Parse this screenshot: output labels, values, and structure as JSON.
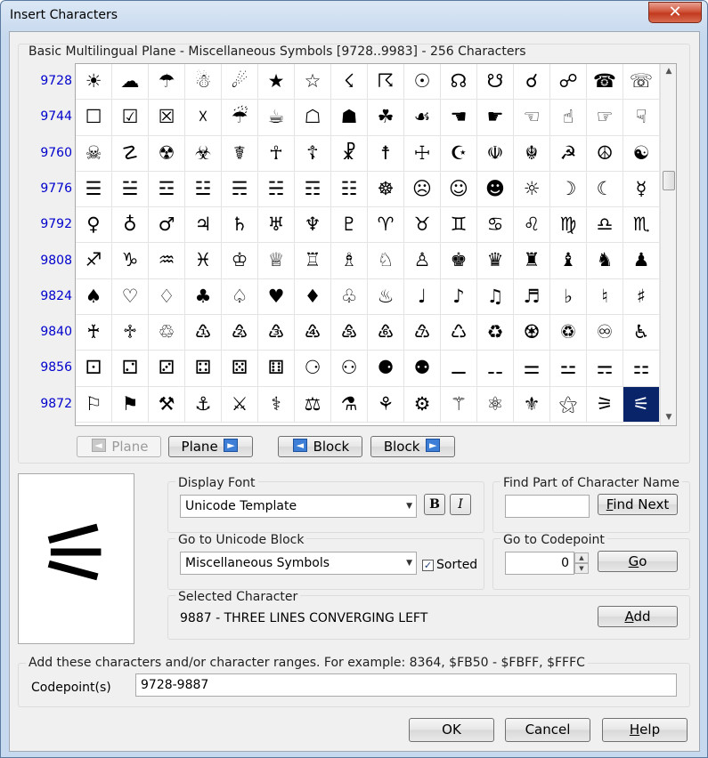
{
  "window": {
    "title": "Insert Characters",
    "close_glyph": "✕"
  },
  "char_panel": {
    "group_label": "Basic Multilingual Plane - Miscellaneous Symbols [9728..9983] - 256 Characters",
    "row_labels": [
      "9728",
      "9744",
      "9760",
      "9776",
      "9792",
      "9808",
      "9824",
      "9840",
      "9856",
      "9872"
    ],
    "glyph_rows": [
      [
        "☀",
        "☁",
        "☂",
        "☃",
        "☄",
        "★",
        "☆",
        "☇",
        "☈",
        "☉",
        "☊",
        "☋",
        "☌",
        "☍",
        "☎",
        "☏"
      ],
      [
        "☐",
        "☑",
        "☒",
        "☓",
        "☔",
        "☕",
        "☖",
        "☗",
        "☘",
        "☙",
        "☚",
        "☛",
        "☜",
        "☝",
        "☞",
        "☟"
      ],
      [
        "☠",
        "☡",
        "☢",
        "☣",
        "☤",
        "☥",
        "☦",
        "☧",
        "☨",
        "☩",
        "☪",
        "☫",
        "☬",
        "☭",
        "☮",
        "☯"
      ],
      [
        "☰",
        "☱",
        "☲",
        "☳",
        "☴",
        "☵",
        "☶",
        "☷",
        "☸",
        "☹",
        "☺",
        "☻",
        "☼",
        "☽",
        "☾",
        "☿"
      ],
      [
        "♀",
        "♁",
        "♂",
        "♃",
        "♄",
        "♅",
        "♆",
        "♇",
        "♈",
        "♉",
        "♊",
        "♋",
        "♌",
        "♍",
        "♎",
        "♏"
      ],
      [
        "♐",
        "♑",
        "♒",
        "♓",
        "♔",
        "♕",
        "♖",
        "♗",
        "♘",
        "♙",
        "♚",
        "♛",
        "♜",
        "♝",
        "♞",
        "♟"
      ],
      [
        "♠",
        "♡",
        "♢",
        "♣",
        "♤",
        "♥",
        "♦",
        "♧",
        "♨",
        "♩",
        "♪",
        "♫",
        "♬",
        "♭",
        "♮",
        "♯"
      ],
      [
        "♰",
        "♱",
        "♲",
        "♳",
        "♴",
        "♵",
        "♶",
        "♷",
        "♸",
        "♹",
        "♺",
        "♻",
        "♼",
        "♽",
        "♾",
        "♿"
      ],
      [
        "⚀",
        "⚁",
        "⚂",
        "⚃",
        "⚄",
        "⚅",
        "⚆",
        "⚇",
        "⚈",
        "⚉",
        "⚊",
        "⚋",
        "⚌",
        "⚍",
        "⚎",
        "⚏"
      ],
      [
        "⚐",
        "⚑",
        "⚒",
        "⚓",
        "⚔",
        "⚕",
        "⚖",
        "⚗",
        "⚘",
        "⚙",
        "⚚",
        "⚛",
        "⚜",
        "⚝",
        "⚞",
        "⚟"
      ]
    ],
    "selected_glyph": "⚟",
    "scroll_up": "▲",
    "scroll_down": "▼",
    "nav": {
      "prev_plane": "Plane",
      "next_plane": "Plane",
      "prev_block": "Block",
      "next_block": "Block",
      "left_arrow": "◄",
      "right_arrow": "►"
    }
  },
  "preview": {
    "glyph": "⚟"
  },
  "display_font": {
    "group_label": "Display Font",
    "value": "Unicode Template",
    "bold": "B",
    "italic": "I"
  },
  "find_name": {
    "group_label": "Find Part of Character Name",
    "value": "",
    "button": "Find Next"
  },
  "unicode_block": {
    "group_label": "Go to Unicode Block",
    "value": "Miscellaneous Symbols",
    "sorted_label": "Sorted",
    "sorted_checked": true
  },
  "codepoint_goto": {
    "group_label": "Go to Codepoint",
    "value": "0",
    "button": "Go"
  },
  "selected_char": {
    "group_label": "Selected Character",
    "text": "9887 - THREE LINES CONVERGING LEFT",
    "button": "Add"
  },
  "add_chars": {
    "group_label": "Add these characters and/or character ranges. For example: 8364, $FB50 - $FBFF, $FFFC",
    "field_label": "Codepoint(s)",
    "value": "9728-9887"
  },
  "footer": {
    "ok": "OK",
    "cancel": "Cancel",
    "help": "Help"
  },
  "colors": {
    "selected_cell_bg": "#0a246a",
    "row_label": "#0000cc"
  }
}
